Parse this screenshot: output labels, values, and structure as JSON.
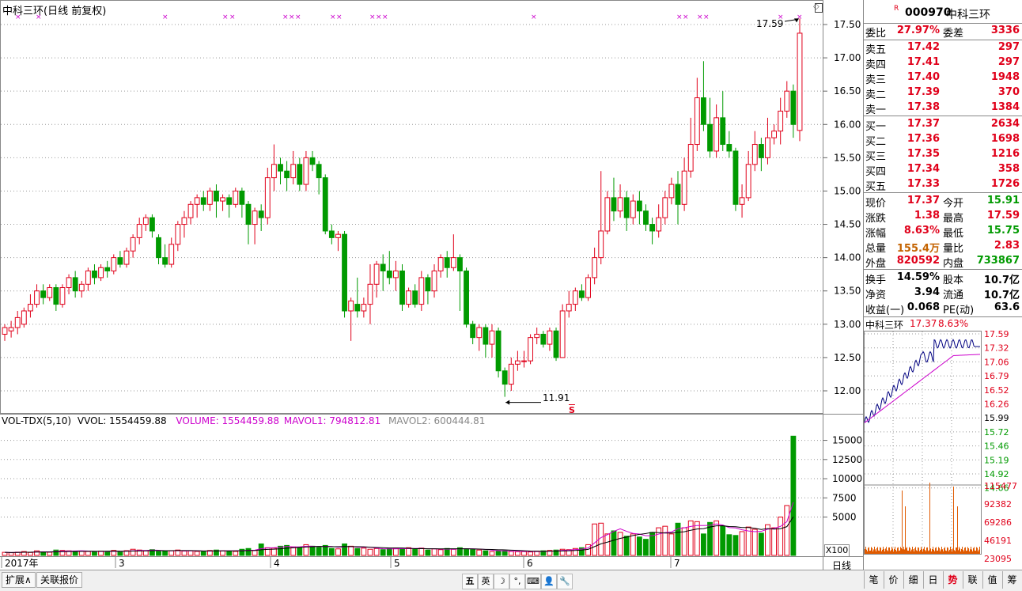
{
  "chart_title": "中科三环(日线 前复权)",
  "vol_indicator": {
    "name": "VOL-TDX(5,10)",
    "vvol": "VVOL: 1554459.88",
    "volume": "VOLUME: 1554459.88",
    "mavol1": "MAVOL1: 794812.81",
    "mavol2": "MAVOL2: 600444.81"
  },
  "price_axis": [
    "17.50",
    "17.00",
    "16.50",
    "16.00",
    "15.50",
    "15.00",
    "14.50",
    "14.00",
    "13.50",
    "13.00",
    "12.50",
    "12.00"
  ],
  "volume_axis": [
    "15000",
    "12500",
    "10000",
    "7500",
    "5000"
  ],
  "vol_unit": "X100",
  "time_axis": [
    "2017年",
    "3",
    "4",
    "5",
    "6",
    "7"
  ],
  "high_marker": "17.59",
  "low_marker": "11.91",
  "s_marker": "S",
  "period_label": "日线",
  "bottom_tabs": [
    "扩展∧",
    "关联报价"
  ],
  "toolbar": [
    "五",
    "英",
    "☽",
    "°,",
    "⌨",
    "👤",
    "🔧"
  ],
  "right_tabs": [
    "笔",
    "价",
    "细",
    "日",
    "势",
    "联",
    "值",
    "筹"
  ],
  "quote": {
    "marker": "R",
    "code": "000970",
    "name": "中科三环",
    "webi_label": "委比",
    "webi": "27.97%",
    "weicha_label": "委差",
    "weicha": "3336",
    "sell": [
      {
        "label": "卖五",
        "price": "17.42",
        "vol": "297"
      },
      {
        "label": "卖四",
        "price": "17.41",
        "vol": "297"
      },
      {
        "label": "卖三",
        "price": "17.40",
        "vol": "1948"
      },
      {
        "label": "卖二",
        "price": "17.39",
        "vol": "370"
      },
      {
        "label": "卖一",
        "price": "17.38",
        "vol": "1384"
      }
    ],
    "buy": [
      {
        "label": "买一",
        "price": "17.37",
        "vol": "2634"
      },
      {
        "label": "买二",
        "price": "17.36",
        "vol": "1698"
      },
      {
        "label": "买三",
        "price": "17.35",
        "vol": "1216"
      },
      {
        "label": "买四",
        "price": "17.34",
        "vol": "358"
      },
      {
        "label": "买五",
        "price": "17.33",
        "vol": "1726"
      }
    ],
    "stats": [
      {
        "l1": "现价",
        "v1": "17.37",
        "l2": "今开",
        "v2": "15.91"
      },
      {
        "l1": "涨跌",
        "v1": "1.38",
        "l2": "最高",
        "v2": "17.59"
      },
      {
        "l1": "涨幅",
        "v1": "8.63%",
        "l2": "最低",
        "v2": "15.75"
      },
      {
        "l1": "总量",
        "v1": "155.4万",
        "l2": "量比",
        "v2": "2.83"
      },
      {
        "l1": "外盘",
        "v1": "820592",
        "l2": "内盘",
        "v2": "733867"
      }
    ],
    "fundamentals": [
      {
        "l1": "换手",
        "v1": "14.59%",
        "l2": "股本",
        "v2": "10.7亿"
      },
      {
        "l1": "净资",
        "v1": "3.94",
        "l2": "流通",
        "v2": "10.7亿"
      },
      {
        "l1": "收益(一)",
        "v1": "0.068",
        "l2": "PE(动)",
        "v2": "63.6"
      }
    ]
  },
  "mini": {
    "name": "中科三环",
    "price": "17.37",
    "pct": "8.63%",
    "price_axis": [
      "17.59",
      "17.32",
      "17.06",
      "16.79",
      "16.52",
      "16.26",
      "15.99",
      "15.72",
      "15.46",
      "15.19",
      "14.92",
      "14.66"
    ],
    "vol_axis": [
      "115477",
      "92382",
      "69286",
      "46191",
      "23095"
    ]
  },
  "chart_data": {
    "type": "candlestick",
    "title": "中科三环(日线 前复权)",
    "ylim": [
      11.7,
      17.8
    ],
    "x_ticks": [
      "2017年",
      "3",
      "4",
      "5",
      "6",
      "7"
    ],
    "candles": [
      [
        12.85,
        12.95,
        12.75,
        13.0
      ],
      [
        12.9,
        12.95,
        12.8,
        13.05
      ],
      [
        12.95,
        13.1,
        12.85,
        13.2
      ],
      [
        13.0,
        13.2,
        12.95,
        13.25
      ],
      [
        13.2,
        13.3,
        13.1,
        13.45
      ],
      [
        13.3,
        13.5,
        13.25,
        13.6
      ],
      [
        13.5,
        13.4,
        13.3,
        13.6
      ],
      [
        13.4,
        13.55,
        13.35,
        13.6
      ],
      [
        13.55,
        13.3,
        13.2,
        13.6
      ],
      [
        13.3,
        13.55,
        13.25,
        13.6
      ],
      [
        13.55,
        13.7,
        13.45,
        13.75
      ],
      [
        13.7,
        13.5,
        13.4,
        13.8
      ],
      [
        13.5,
        13.6,
        13.4,
        13.65
      ],
      [
        13.6,
        13.8,
        13.5,
        13.85
      ],
      [
        13.8,
        13.7,
        13.6,
        13.9
      ],
      [
        13.7,
        13.85,
        13.65,
        13.9
      ],
      [
        13.85,
        13.8,
        13.7,
        13.95
      ],
      [
        13.8,
        14.0,
        13.75,
        14.05
      ],
      [
        14.0,
        13.9,
        13.85,
        14.1
      ],
      [
        13.9,
        14.1,
        13.85,
        14.15
      ],
      [
        14.1,
        14.3,
        14.0,
        14.35
      ],
      [
        14.3,
        14.5,
        14.2,
        14.6
      ],
      [
        14.5,
        14.6,
        14.4,
        14.65
      ],
      [
        14.6,
        14.4,
        14.3,
        14.65
      ],
      [
        14.3,
        14.0,
        13.9,
        14.35
      ],
      [
        14.0,
        13.9,
        13.85,
        14.2
      ],
      [
        13.9,
        14.2,
        13.85,
        14.3
      ],
      [
        14.2,
        14.5,
        14.1,
        14.55
      ],
      [
        14.5,
        14.6,
        14.3,
        14.7
      ],
      [
        14.6,
        14.8,
        14.5,
        14.85
      ],
      [
        14.8,
        14.9,
        14.6,
        14.95
      ],
      [
        14.9,
        14.8,
        14.7,
        15.0
      ],
      [
        14.8,
        15.0,
        14.7,
        15.05
      ],
      [
        15.0,
        14.85,
        14.6,
        15.1
      ],
      [
        14.85,
        14.9,
        14.7,
        14.95
      ],
      [
        14.9,
        14.8,
        14.6,
        14.95
      ],
      [
        14.8,
        15.0,
        14.75,
        15.05
      ],
      [
        15.0,
        14.8,
        14.6,
        15.05
      ],
      [
        14.8,
        14.5,
        14.2,
        14.85
      ],
      [
        14.5,
        14.7,
        14.2,
        14.75
      ],
      [
        14.7,
        14.6,
        14.4,
        14.8
      ],
      [
        14.6,
        15.2,
        14.5,
        15.35
      ],
      [
        15.2,
        15.4,
        15.0,
        15.7
      ],
      [
        15.4,
        15.3,
        15.1,
        15.5
      ],
      [
        15.3,
        15.2,
        15.0,
        15.45
      ],
      [
        15.2,
        15.4,
        15.1,
        15.6
      ],
      [
        15.4,
        15.1,
        15.0,
        15.5
      ],
      [
        15.1,
        15.5,
        15.0,
        15.6
      ],
      [
        15.5,
        15.4,
        15.3,
        15.6
      ],
      [
        15.4,
        15.2,
        14.95,
        15.45
      ],
      [
        15.2,
        14.4,
        14.35,
        15.25
      ],
      [
        14.4,
        14.3,
        14.2,
        14.5
      ],
      [
        14.3,
        14.35,
        14.1,
        14.4
      ],
      [
        14.35,
        13.2,
        13.1,
        14.4
      ],
      [
        13.2,
        13.35,
        12.75,
        13.4
      ],
      [
        13.3,
        13.2,
        13.1,
        13.7
      ],
      [
        13.2,
        13.3,
        13.1,
        13.4
      ],
      [
        13.3,
        13.6,
        13.0,
        13.9
      ],
      [
        13.6,
        13.9,
        13.4,
        13.95
      ],
      [
        13.9,
        13.8,
        13.5,
        14.05
      ],
      [
        13.8,
        13.7,
        13.6,
        14.1
      ],
      [
        13.7,
        13.8,
        13.5,
        13.95
      ],
      [
        13.8,
        13.3,
        13.2,
        13.9
      ],
      [
        13.3,
        13.5,
        13.25,
        13.55
      ],
      [
        13.5,
        13.3,
        13.25,
        13.6
      ],
      [
        13.3,
        13.7,
        13.2,
        13.8
      ],
      [
        13.7,
        13.5,
        13.3,
        13.75
      ],
      [
        13.5,
        13.8,
        13.4,
        13.9
      ],
      [
        13.8,
        14.0,
        13.7,
        14.05
      ],
      [
        14.0,
        13.85,
        13.7,
        14.1
      ],
      [
        13.85,
        14.0,
        13.8,
        14.35
      ],
      [
        14.0,
        13.8,
        13.2,
        14.05
      ],
      [
        13.8,
        13.0,
        12.95,
        13.85
      ],
      [
        13.0,
        12.8,
        12.7,
        13.05
      ],
      [
        12.8,
        12.95,
        12.6,
        13.0
      ],
      [
        12.95,
        12.7,
        12.5,
        13.0
      ],
      [
        12.7,
        12.9,
        12.5,
        13.0
      ],
      [
        12.9,
        12.3,
        12.2,
        12.95
      ],
      [
        12.3,
        12.1,
        11.91,
        12.35
      ],
      [
        12.1,
        12.4,
        12.0,
        12.5
      ],
      [
        12.4,
        12.45,
        12.3,
        12.6
      ],
      [
        12.45,
        12.45,
        12.35,
        12.6
      ],
      [
        12.45,
        12.8,
        12.4,
        12.85
      ],
      [
        12.8,
        12.85,
        12.7,
        12.95
      ],
      [
        12.85,
        12.7,
        12.65,
        12.9
      ],
      [
        12.7,
        12.9,
        12.6,
        12.95
      ],
      [
        12.9,
        12.5,
        12.45,
        12.95
      ],
      [
        12.5,
        13.2,
        12.5,
        13.3
      ],
      [
        13.2,
        13.3,
        13.1,
        13.5
      ],
      [
        13.3,
        13.5,
        13.2,
        13.55
      ],
      [
        13.5,
        13.4,
        13.35,
        13.6
      ],
      [
        13.4,
        13.7,
        13.35,
        13.75
      ],
      [
        13.7,
        14.0,
        13.6,
        14.15
      ],
      [
        14.0,
        14.4,
        13.9,
        15.3
      ],
      [
        14.4,
        14.9,
        14.35,
        15.0
      ],
      [
        14.9,
        14.7,
        14.55,
        15.2
      ],
      [
        14.7,
        14.9,
        14.6,
        15.1
      ],
      [
        14.9,
        14.6,
        14.4,
        15.0
      ],
      [
        14.6,
        14.85,
        14.5,
        14.95
      ],
      [
        14.85,
        14.7,
        14.5,
        15.0
      ],
      [
        14.7,
        14.5,
        14.4,
        14.8
      ],
      [
        14.5,
        14.4,
        14.2,
        14.6
      ],
      [
        14.4,
        14.6,
        14.3,
        14.8
      ],
      [
        14.6,
        14.9,
        14.5,
        15.0
      ],
      [
        14.9,
        15.1,
        14.8,
        15.2
      ],
      [
        15.1,
        14.8,
        14.5,
        15.3
      ],
      [
        14.8,
        15.3,
        14.7,
        15.5
      ],
      [
        15.3,
        15.7,
        15.2,
        16.1
      ],
      [
        15.7,
        16.4,
        15.6,
        16.7
      ],
      [
        16.4,
        16.0,
        15.9,
        16.95
      ],
      [
        16.0,
        15.6,
        15.5,
        16.4
      ],
      [
        15.6,
        16.1,
        15.5,
        16.3
      ],
      [
        16.1,
        15.7,
        15.6,
        16.5
      ],
      [
        15.7,
        15.6,
        15.5,
        15.9
      ],
      [
        15.6,
        14.8,
        14.7,
        15.65
      ],
      [
        14.8,
        14.9,
        14.6,
        15.1
      ],
      [
        14.9,
        15.4,
        14.85,
        15.6
      ],
      [
        15.4,
        15.7,
        15.3,
        15.9
      ],
      [
        15.7,
        15.5,
        15.3,
        15.8
      ],
      [
        15.5,
        15.8,
        15.4,
        16.1
      ],
      [
        15.8,
        15.9,
        15.7,
        16.0
      ],
      [
        15.9,
        16.2,
        15.7,
        16.4
      ],
      [
        16.2,
        16.5,
        16.1,
        16.65
      ],
      [
        16.5,
        16.0,
        15.8,
        16.6
      ],
      [
        15.91,
        17.37,
        15.75,
        17.59
      ]
    ],
    "volume_ylim": [
      0,
      16500
    ],
    "volumes": [
      400,
      350,
      420,
      500,
      380,
      600,
      450,
      420,
      700,
      650,
      600,
      500,
      550,
      520,
      480,
      560,
      500,
      650,
      480,
      620,
      800,
      700,
      600,
      750,
      500,
      520,
      600,
      700,
      560,
      600,
      520,
      480,
      640,
      700,
      600,
      550,
      520,
      800,
      900,
      650,
      1500,
      1000,
      950,
      1200,
      1300,
      1100,
      1000,
      1400,
      1200,
      1050,
      1300,
      900,
      850,
      1500,
      1200,
      900,
      950,
      800,
      900,
      750,
      880,
      950,
      900,
      1000,
      800,
      950,
      700,
      850,
      750,
      900,
      800,
      1000,
      850,
      750,
      700,
      600,
      500,
      550,
      600,
      520,
      480,
      500,
      450,
      560,
      600,
      650,
      700,
      800,
      750,
      900,
      1000,
      1400,
      4100,
      4200,
      2800,
      3200,
      3000,
      2500,
      2800,
      2400,
      2100,
      3000,
      3600,
      3800,
      2800,
      4200,
      3600,
      4500,
      4400,
      2800,
      4300,
      4500,
      3800,
      2700,
      2600,
      3100,
      3700,
      3400,
      2900,
      4000,
      3600,
      5000,
      6500,
      15544
    ],
    "mavol1_color": "#cc00cc",
    "mavol2_color": "#000000",
    "up_color": "#e0001a",
    "down_color": "#009a00"
  }
}
